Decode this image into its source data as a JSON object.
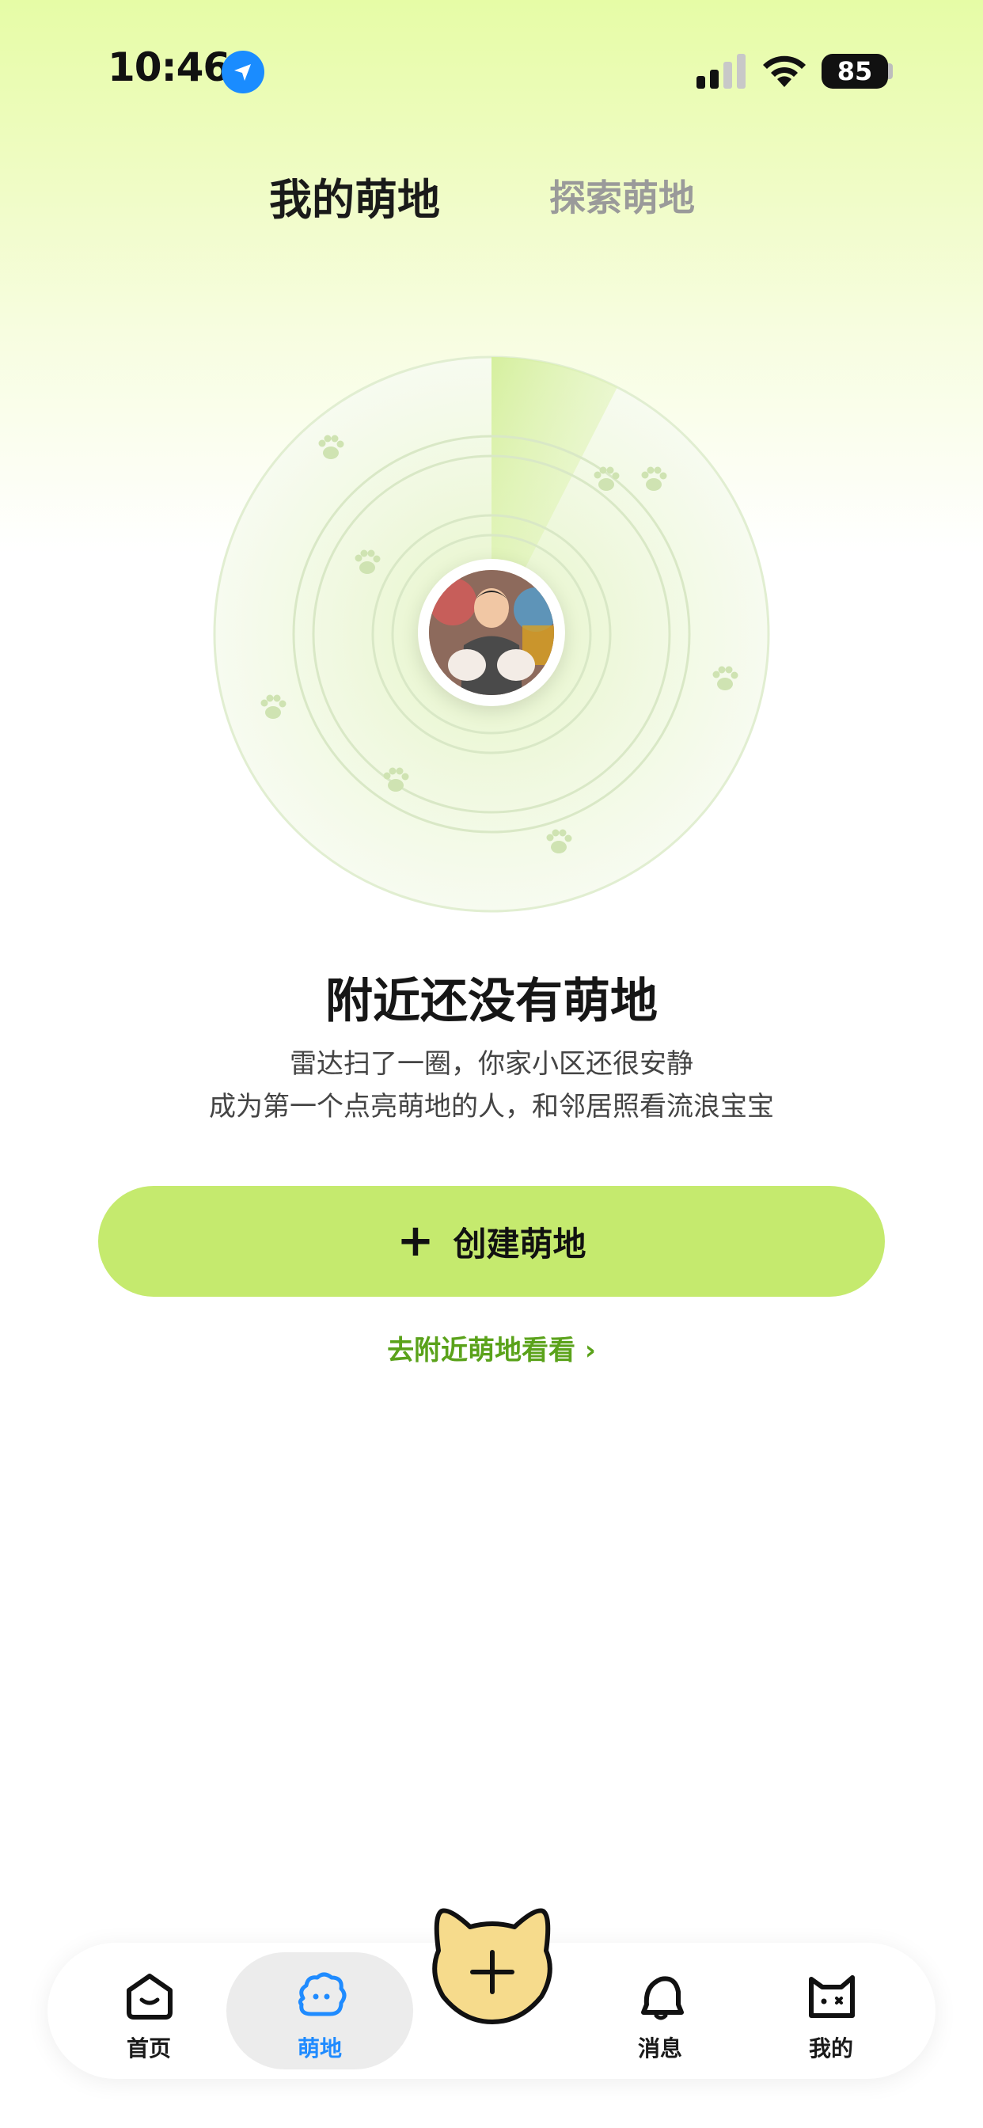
{
  "status_bar": {
    "time": "10:46",
    "battery": "85"
  },
  "tabs": {
    "mine": "我的萌地",
    "explore": "探索萌地"
  },
  "empty_state": {
    "title": "附近还没有萌地",
    "line1": "雷达扫了一圈，你家小区还很安静",
    "line2": "成为第一个点亮萌地的人，和邻居照看流浪宝宝"
  },
  "create_button": {
    "label": "创建萌地"
  },
  "nearby_link": "去附近萌地看看 ›",
  "tab_bar": {
    "home": "首页",
    "mengdi": "萌地",
    "messages": "消息",
    "mine": "我的"
  },
  "colors": {
    "accent": "#c5ea6e",
    "active_tab": "#1f8bff",
    "link": "#5aa21a"
  }
}
